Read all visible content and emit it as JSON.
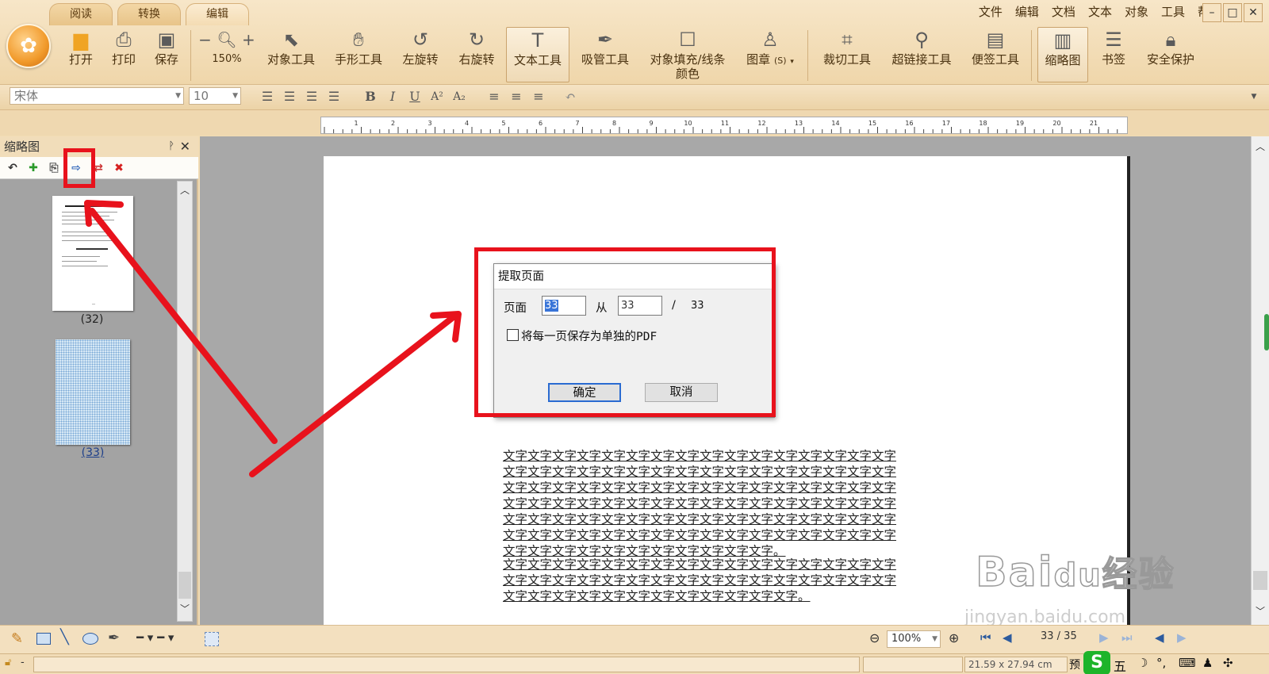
{
  "ribbon": {
    "tabs": [
      "阅读",
      "转换",
      "编辑"
    ],
    "menu": [
      "文件",
      "编辑",
      "文档",
      "文本",
      "对象",
      "工具",
      "帮助"
    ],
    "tools": {
      "open": "打开",
      "print": "打印",
      "save": "保存",
      "zoom_minus": "−",
      "zoom_plus": "+",
      "zoom_value": "150%",
      "object_tool": "对象工具",
      "hand_tool": "手形工具",
      "rotate_left": "左旋转",
      "rotate_right": "右旋转",
      "text_tool": "文本工具",
      "eyedropper": "吸管工具",
      "fill_line_1": "对象填充/线条",
      "fill_line_2": "颜色",
      "stamp": "图章",
      "stamp_key": "(S)",
      "crop": "裁切工具",
      "hyperlink": "超链接工具",
      "note": "便签工具",
      "thumbnail": "缩略图",
      "bookmark": "书签",
      "security": "安全保护"
    }
  },
  "format": {
    "font": "宋体",
    "size": "10"
  },
  "ruler": {
    "marks": [
      "1",
      "2",
      "3",
      "4",
      "5",
      "6",
      "7",
      "8",
      "9",
      "10",
      "11",
      "12",
      "13",
      "14",
      "15",
      "16",
      "17",
      "18",
      "19",
      "20",
      "21"
    ]
  },
  "left_panel": {
    "title": "缩略图",
    "thumbs": [
      {
        "label": "(32)"
      },
      {
        "label": "(33)"
      }
    ]
  },
  "document": {
    "para1": [
      "文字文字文字文字文字文字文字文字文字文字文字文字文字文字文字文字",
      "文字文字文字文字文字文字文字文字文字文字文字文字文字文字文字文字",
      "文字文字文字文字文字文字文字文字文字文字文字文字文字文字文字文字",
      "文字文字文字文字文字文字文字文字文字文字文字文字文字文字文字文字",
      "文字文字文字文字文字文字文字文字文字文字文字文字文字文字文字文字",
      "文字文字文字文字文字文字文字文字文字文字文字文字文字文字文字文字"
    ],
    "para1_last": "文字文字文字文字文字文字文字文字文字文字文字。",
    "para2": [
      "文字文字文字文字文字文字文字文字文字文字文字文字文字文字文字文字",
      "文字文字文字文字文字文字文字文字文字文字文字文字文字文字文字文字"
    ],
    "para2_last": "文字文字文字文字文字文字文字文字文字文字文字文字。"
  },
  "dialog": {
    "title": "提取页面",
    "page_label": "页面",
    "page_from": "33",
    "from_label": "从",
    "page_to": "33",
    "sep": "/",
    "total": "33",
    "checkbox_label": "将每一页保存为单独的PDF",
    "checkbox_checked": false,
    "ok": "确定",
    "cancel": "取消"
  },
  "bottom": {
    "zoom": "100%",
    "page_indicator": "33 / 35",
    "page_size": "21.59 x 27.94 cm",
    "preview": "预",
    "ime": "五"
  },
  "watermark": {
    "brand": "Bai",
    "brand2": "du",
    "sub": "经验",
    "url": "jingyan.baidu.com"
  },
  "colors": {
    "accent_red": "#e8121c",
    "ribbon": "#f2dcb4",
    "selection": "#3874d8"
  }
}
